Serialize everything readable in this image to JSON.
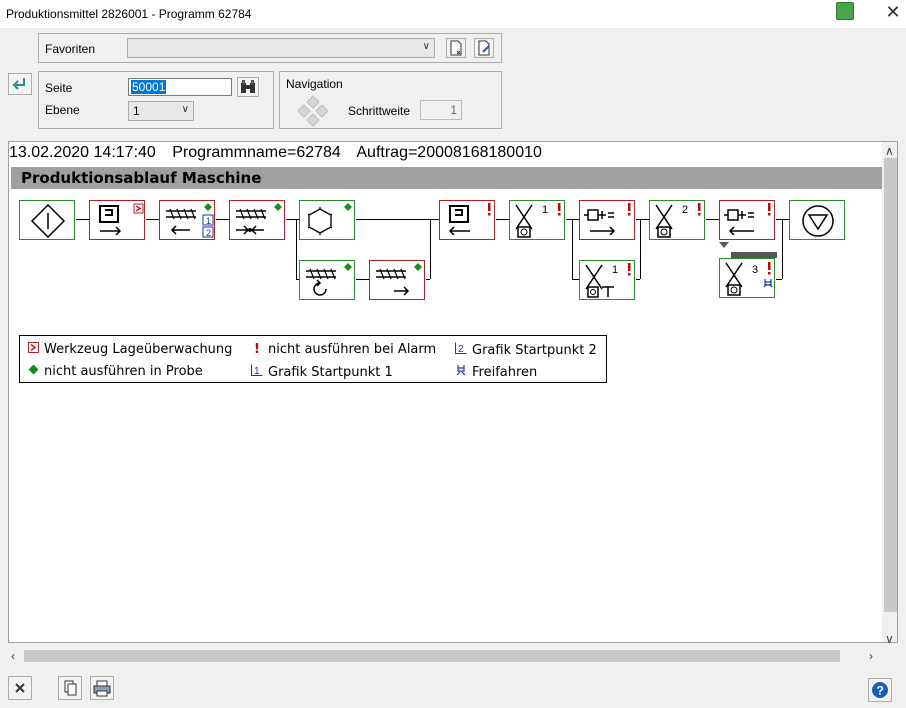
{
  "window": {
    "title": "Produktionsmittel 2826001 - Programm 62784",
    "close_glyph": "✕"
  },
  "favoriten": {
    "label": "Favoriten",
    "value": ""
  },
  "seite": {
    "label": "Seite",
    "value": "50001"
  },
  "ebene": {
    "label": "Ebene",
    "value": "1"
  },
  "navigation": {
    "title": "Navigation",
    "step_label": "Schrittweite",
    "step_value": "1"
  },
  "header": {
    "datetime": "13.02.2020 14:17:40",
    "programmname": "Programmname=62784",
    "auftrag": "Auftrag=20008168180010"
  },
  "section_title": "Produktionsablauf Maschine",
  "flow": {
    "numbers": {
      "n6": "1",
      "n9": "2",
      "m2": "1",
      "m3": "3"
    },
    "badges": {
      "sp1": "1",
      "sp2": "2"
    }
  },
  "legend": {
    "items": [
      {
        "symbol": "werkzeug-lage-icon",
        "text": "Werkzeug Lageüberwachung"
      },
      {
        "symbol": "alarm-icon",
        "text": "nicht ausführen bei Alarm"
      },
      {
        "symbol": "startpunkt-2-icon",
        "text": "Grafik Startpunkt 2"
      },
      {
        "symbol": "probe-icon",
        "text": "nicht ausführen in Probe"
      },
      {
        "symbol": "startpunkt-1-icon",
        "text": "Grafik Startpunkt 1"
      },
      {
        "symbol": "freifahren-icon",
        "text": "Freifahren"
      }
    ],
    "num1": "1",
    "num2": "2",
    "alarm": "!"
  },
  "colors": {
    "green": "#2a8c2a",
    "red": "#b22222",
    "diamond": "#1a8c1a",
    "alarm": "#cc0000",
    "blue": "#1a3a9c"
  }
}
